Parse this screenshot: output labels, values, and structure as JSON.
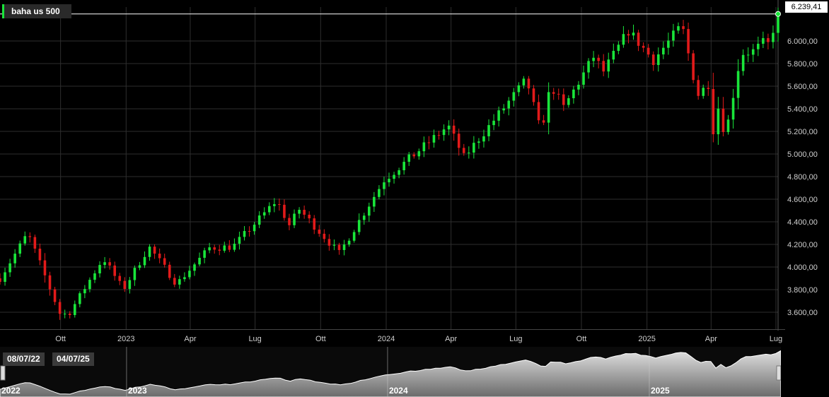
{
  "chart_data": {
    "type": "candlestick",
    "series_label": "baha us 500",
    "last_value_label": "6.239,41",
    "last_value": 6239.41,
    "colors": {
      "up": "#19e63a",
      "down": "#e21a1a",
      "background": "#000000",
      "grid": "#2e2e2e"
    },
    "grid": true,
    "ylim": [
      3450,
      6300
    ],
    "y_ticks": [
      {
        "value": 3600,
        "label": "3.600,00"
      },
      {
        "value": 3800,
        "label": "3.800,00"
      },
      {
        "value": 4000,
        "label": "4.000,00"
      },
      {
        "value": 4200,
        "label": "4.200,00"
      },
      {
        "value": 4400,
        "label": "4.400,00"
      },
      {
        "value": 4600,
        "label": "4.600,00"
      },
      {
        "value": 4800,
        "label": "4.800,00"
      },
      {
        "value": 5000,
        "label": "5.000,00"
      },
      {
        "value": 5200,
        "label": "5.200,00"
      },
      {
        "value": 5400,
        "label": "5.400,00"
      },
      {
        "value": 5600,
        "label": "5.600,00"
      },
      {
        "value": 5800,
        "label": "5.800,00"
      },
      {
        "value": 6000,
        "label": "6.000,00"
      }
    ],
    "x_start": "2022-07-08",
    "x_end": "2025-07-04",
    "x_ticks": [
      {
        "date": "2022-10-01",
        "label": "Ott"
      },
      {
        "date": "2023-01-01",
        "label": "2023"
      },
      {
        "date": "2023-04-01",
        "label": "Apr"
      },
      {
        "date": "2023-07-01",
        "label": "Lug"
      },
      {
        "date": "2023-10-01",
        "label": "Ott"
      },
      {
        "date": "2024-01-01",
        "label": "2024"
      },
      {
        "date": "2024-04-01",
        "label": "Apr"
      },
      {
        "date": "2024-07-01",
        "label": "Lug"
      },
      {
        "date": "2024-10-01",
        "label": "Ott"
      },
      {
        "date": "2025-01-01",
        "label": "2025"
      },
      {
        "date": "2025-04-01",
        "label": "Apr"
      },
      {
        "date": "2025-07-01",
        "label": "Lug"
      }
    ],
    "trend_points": [
      {
        "date": "2022-07-08",
        "close": 3900
      },
      {
        "date": "2022-08-16",
        "close": 4300
      },
      {
        "date": "2022-09-30",
        "close": 3590
      },
      {
        "date": "2022-10-12",
        "close": 3580
      },
      {
        "date": "2022-11-30",
        "close": 4080
      },
      {
        "date": "2022-12-28",
        "close": 3800
      },
      {
        "date": "2023-02-02",
        "close": 4180
      },
      {
        "date": "2023-03-13",
        "close": 3850
      },
      {
        "date": "2023-04-28",
        "close": 4170
      },
      {
        "date": "2023-05-31",
        "close": 4180
      },
      {
        "date": "2023-07-31",
        "close": 4590
      },
      {
        "date": "2023-08-18",
        "close": 4370
      },
      {
        "date": "2023-09-01",
        "close": 4510
      },
      {
        "date": "2023-10-27",
        "close": 4120
      },
      {
        "date": "2023-12-29",
        "close": 4770
      },
      {
        "date": "2024-03-28",
        "close": 5250
      },
      {
        "date": "2024-04-19",
        "close": 4970
      },
      {
        "date": "2024-07-16",
        "close": 5660
      },
      {
        "date": "2024-08-05",
        "close": 5190
      },
      {
        "date": "2024-08-19",
        "close": 5610
      },
      {
        "date": "2024-09-06",
        "close": 5410
      },
      {
        "date": "2024-10-18",
        "close": 5860
      },
      {
        "date": "2024-11-01",
        "close": 5730
      },
      {
        "date": "2024-12-06",
        "close": 6090
      },
      {
        "date": "2025-01-10",
        "close": 5830
      },
      {
        "date": "2025-02-19",
        "close": 6140
      },
      {
        "date": "2025-03-13",
        "close": 5520
      },
      {
        "date": "2025-03-28",
        "close": 5620
      },
      {
        "date": "2025-04-08",
        "close": 4980
      },
      {
        "date": "2025-04-09",
        "close": 5460
      },
      {
        "date": "2025-04-21",
        "close": 5160
      },
      {
        "date": "2025-05-13",
        "close": 5890
      },
      {
        "date": "2025-05-30",
        "close": 5910
      },
      {
        "date": "2025-06-13",
        "close": 5980
      },
      {
        "date": "2025-06-20",
        "close": 5970
      },
      {
        "date": "2025-07-04",
        "close": 6239.41
      }
    ],
    "navigator": {
      "range_start_label": "08/07/22",
      "range_end_label": "04/07/25",
      "year_labels": [
        {
          "date": "2022-07-08",
          "label": "2022"
        },
        {
          "date": "2023-01-01",
          "label": "2023"
        },
        {
          "date": "2024-01-01",
          "label": "2024"
        },
        {
          "date": "2025-01-01",
          "label": "2025"
        }
      ]
    }
  }
}
